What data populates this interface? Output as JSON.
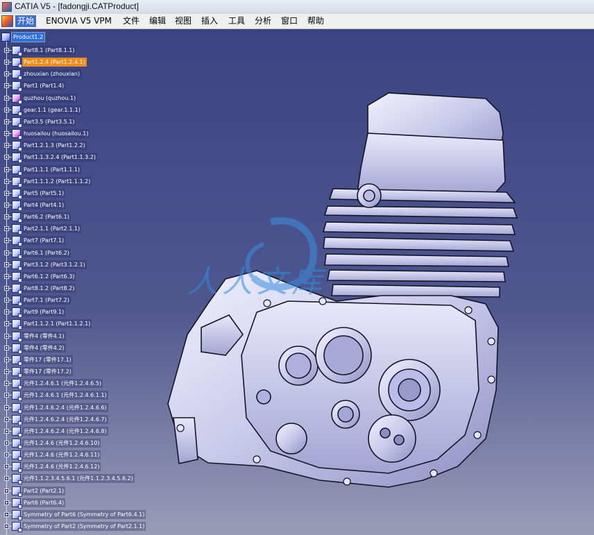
{
  "window": {
    "title": "CATIA V5 - [fadongji.CATProduct]"
  },
  "menu": {
    "items": [
      {
        "label": "开始",
        "active": true
      },
      {
        "label": "ENOVIA V5 VPM"
      },
      {
        "label": "文件"
      },
      {
        "label": "编辑"
      },
      {
        "label": "视图"
      },
      {
        "label": "插入"
      },
      {
        "label": "工具"
      },
      {
        "label": "分析"
      },
      {
        "label": "窗口"
      },
      {
        "label": "帮助"
      }
    ]
  },
  "tree": {
    "root": "Product1.2",
    "nodes": [
      {
        "label": "Part8.1 (Part8.1.1)"
      },
      {
        "label": "Part1.2.4 (Part1.2.4.1)",
        "state": "selected-orange"
      },
      {
        "label": "zhouxian (zhouxian)"
      },
      {
        "label": "Part1 (Part1.4)"
      },
      {
        "label": "quzhou (quzhou.1)",
        "icon": "magenta"
      },
      {
        "label": "gear.1.1 (gear.1.1.1)"
      },
      {
        "label": "Part3.5 (Part3.5.1)"
      },
      {
        "label": "huosailou (huosailou.1)",
        "icon": "magenta"
      },
      {
        "label": "Part1.2.1.3 (Part1.2.2)"
      },
      {
        "label": "Part1.1.3.2.4 (Part1.1.3.2)"
      },
      {
        "label": "Part1.1.1 (Part1.1.1)"
      },
      {
        "label": "Part1.1.1.2 (Part1.1.1.2)"
      },
      {
        "label": "Part5 (Part5.1)"
      },
      {
        "label": "Part4 (Part4.1)"
      },
      {
        "label": "Part6.2 (Part6.1)"
      },
      {
        "label": "Part2.1.1 (Part2.1.1)"
      },
      {
        "label": "Part7 (Part7.1)"
      },
      {
        "label": "Part6.1 (Part6.2)"
      },
      {
        "label": "Part3.1.2 (Part3.1.2.1)"
      },
      {
        "label": "Part6.1.2 (Part6.3)"
      },
      {
        "label": "Part8.1.2 (Part8.2)"
      },
      {
        "label": "Part7.1 (Part7.2)"
      },
      {
        "label": "Part9 (Part9.1)"
      },
      {
        "label": "Part1.1.2.1 (Part1.1.2.1)"
      },
      {
        "label": "零件4 (零件4.1)"
      },
      {
        "label": "零件4 (零件4.2)"
      },
      {
        "label": "零件17 (零件17.1)"
      },
      {
        "label": "零件17 (零件17.2)"
      },
      {
        "label": "元件1.2.4.6.1 (元件1.2.4.6.5)"
      },
      {
        "label": "元件1.2.4.6.1 (元件1.2.4.6.1.1)"
      },
      {
        "label": "元件1.2.4.6.2.4 (元件1.2.4.6.6)"
      },
      {
        "label": "元件1.2.4.6.2.4 (元件1.2.4.6.7)"
      },
      {
        "label": "元件1.2.4.6.2.4 (元件1.2.4.6.8)"
      },
      {
        "label": "元件1.2.4.6 (元件1.2.4.6.10)"
      },
      {
        "label": "元件1.2.4.6 (元件1.2.4.6.11)"
      },
      {
        "label": "元件1.2.4.6 (元件1.2.4.6.12)"
      },
      {
        "label": "元件1.1.2.3.4.5.6.1 (元件1.1.2.3.4.5.6.2)"
      },
      {
        "label": "Part2 (Part2.1)"
      },
      {
        "label": "Part6 (Part6.4)"
      },
      {
        "label": "Symmetry of Part6 (Symmetry of Part6.4.1)"
      },
      {
        "label": "Symmetry of Part2 (Symmetry of Part2.1.1)"
      }
    ]
  },
  "watermark": {
    "text": "人人文库"
  },
  "colors": {
    "selection": "#2f6fe0",
    "highlight": "#f08a1a",
    "background": "#3b4482"
  }
}
